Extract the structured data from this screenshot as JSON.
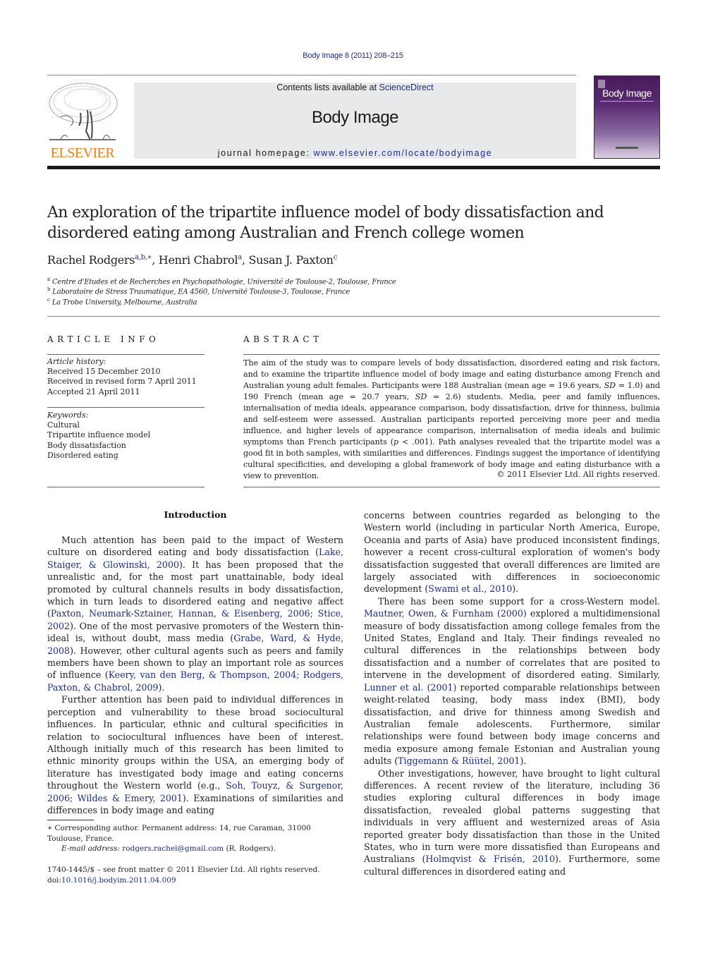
{
  "header": {
    "journal_citation": "Body Image 8 (2011) 208–215",
    "contents_prefix": "Contents lists available at ",
    "contents_link": "ScienceDirect",
    "journal_name": "Body Image",
    "homepage_prefix": "journal homepage: ",
    "homepage_link": "www.elsevier.com/locate/bodyimage",
    "publisher_logo_text": "ELSEVIER",
    "cover_title": "Body Image",
    "colors": {
      "publisher_orange": "#f07f1a",
      "link_blue": "#1c2b8a",
      "cover_purple": "#4a1a5c",
      "banner_gray": "#e8e9ea"
    }
  },
  "article": {
    "title": "An exploration of the tripartite influence model of body dissatisfaction and disordered eating among Australian and French college women",
    "authors": [
      {
        "name": "Rachel Rodgers",
        "sup": "a,b,∗"
      },
      {
        "name": "Henri Chabrol",
        "sup": "a"
      },
      {
        "name": "Susan J. Paxton",
        "sup": "c"
      }
    ],
    "affiliations": [
      {
        "mark": "a",
        "text": "Centre d'Etudes et de Recherches en Psychopathologie, Université de Toulouse-2, Toulouse, France"
      },
      {
        "mark": "b",
        "text": "Laboratoire de Stress Traumatique, EA 4560, Université Toulouse-3, Toulouse, France"
      },
      {
        "mark": "c",
        "text": "La Trobe University, Melbourne, Australia"
      }
    ]
  },
  "article_info": {
    "heading": "ARTICLE INFO",
    "history_label": "Article history:",
    "history": [
      "Received 15 December 2010",
      "Received in revised form 7 April 2011",
      "Accepted 21 April 2011"
    ],
    "keywords_label": "Keywords:",
    "keywords": [
      "Cultural",
      "Tripartite influence model",
      "Body dissatisfaction",
      "Disordered eating"
    ]
  },
  "abstract": {
    "heading": "ABSTRACT",
    "text_1": "The aim of the study was to compare levels of body dissatisfaction, disordered eating and risk factors, and to examine the tripartite influence model of body image and eating disturbance among French and Australian young adult females. Participants were 188 Australian (mean age = 19.6 years, ",
    "sd_label": "SD",
    "text_2": " = 1.0) and 190 French (mean age = 20.7 years, ",
    "text_3": " = 2.6) students. Media, peer and family influences, internalisation of media ideals, appearance comparison, body dissatisfaction, drive for thinness, bulimia and self-esteem were assessed. Australian participants reported perceiving more peer and media influence, and higher levels of appearance comparison, internalisation of media ideals and bulimic symptoms than French participants (",
    "p_label": "p",
    "text_4": " < .001). Path analyses revealed that the tripartite model was a good fit in both samples, with similarities and differences. Findings suggest the importance of identifying cultural specificities, and developing a global framework of body image and eating disturbance with a view to prevention.",
    "copyright": "© 2011 Elsevier Ltd. All rights reserved."
  },
  "body": {
    "section_heading": "Introduction",
    "left": {
      "p1": [
        {
          "t": "Much attention has been paid to the impact of Western culture on disordered eating and body dissatisfaction ("
        },
        {
          "c": "Lake, Staiger, & Glowinski, 2000"
        },
        {
          "t": "). It has been proposed that the unrealistic and, for the most part unattainable, body ideal promoted by cultural channels results in body dissatisfaction, which in turn leads to disordered eating and negative affect ("
        },
        {
          "c": "Paxton, Neumark-Sztainer, Hannan, & Eisenberg, 2006; Stice, 2002"
        },
        {
          "t": "). One of the most pervasive promoters of the Western thin-ideal is, without doubt, mass media ("
        },
        {
          "c": "Grabe, Ward, & Hyde, 2008"
        },
        {
          "t": "). However, other cultural agents such as peers and family members have been shown to play an important role as sources of influence ("
        },
        {
          "c": "Keery, van den Berg, & Thompson, 2004; Rodgers, Paxton, & Chabrol, 2009"
        },
        {
          "t": ")."
        }
      ],
      "p2": [
        {
          "t": "Further attention has been paid to individual differences in perception and vulnerability to these broad sociocultural influences. In particular, ethnic and cultural specificities in relation to sociocultural influences have been of interest. Although initially much of this research has been limited to ethnic minority groups within the USA, an emerging body of literature has investigated body image and eating concerns throughout the Western world (e.g., "
        },
        {
          "c": "Soh, Touyz, & Surgenor, 2006; Wildes & Emery, 2001"
        },
        {
          "t": "). Examinations of similarities and differences in body image and eating"
        }
      ]
    },
    "right": {
      "p1": [
        {
          "t": "concerns between countries regarded as belonging to the Western world (including in particular North America, Europe, Oceania and parts of Asia) have produced inconsistent findings, however a recent cross-cultural exploration of women's body dissatisfaction suggested that overall differences are limited are largely associated with differences in socioeconomic development ("
        },
        {
          "c": "Swami et al., 2010"
        },
        {
          "t": ")."
        }
      ],
      "p2": [
        {
          "t": "There has been some support for a cross-Western model. "
        },
        {
          "c": "Mautner, Owen, & Furnham (2000)"
        },
        {
          "t": " explored a multidimensional measure of body dissatisfaction among college females from the United States, England and Italy. Their findings revealed no cultural differences in the relationships between body dissatisfaction and a number of correlates that are posited to intervene in the development of disordered eating. Similarly, "
        },
        {
          "c": "Lunner et al. (2001)"
        },
        {
          "t": " reported comparable relationships between weight-related teasing, body mass index (BMI), body dissatisfaction, and drive for thinness among Swedish and Australian female adolescents. Furthermore, similar relationships were found between body image concerns and media exposure among female Estonian and Australian young adults ("
        },
        {
          "c": "Tiggemann & Rüütel, 2001"
        },
        {
          "t": ")."
        }
      ],
      "p3": [
        {
          "t": "Other investigations, however, have brought to light cultural differences. A recent review of the literature, including 36 studies exploring cultural differences in body image dissatisfaction, revealed global patterns suggesting that individuals in very affluent and westernized areas of Asia reported greater body dissatisfaction than those in the United States, who in turn were more dissatisfied than Europeans and Australians ("
        },
        {
          "c": "Holmqvist & Frisén, 2010"
        },
        {
          "t": "). Furthermore, some cultural differences in disordered eating and"
        }
      ]
    }
  },
  "footnotes": {
    "corresponding": "∗ Corresponding author. Permanent address: 14, rue Caraman, 31000 Toulouse, France.",
    "email_label": "E-mail address: ",
    "email": "rodgers.rachel@gmail.com",
    "email_suffix": " (R. Rodgers).",
    "issn_line": "1740-1445/$ – see front matter © 2011 Elsevier Ltd. All rights reserved.",
    "doi_prefix": "doi:",
    "doi": "10.1016/j.bodyim.2011.04.009"
  }
}
